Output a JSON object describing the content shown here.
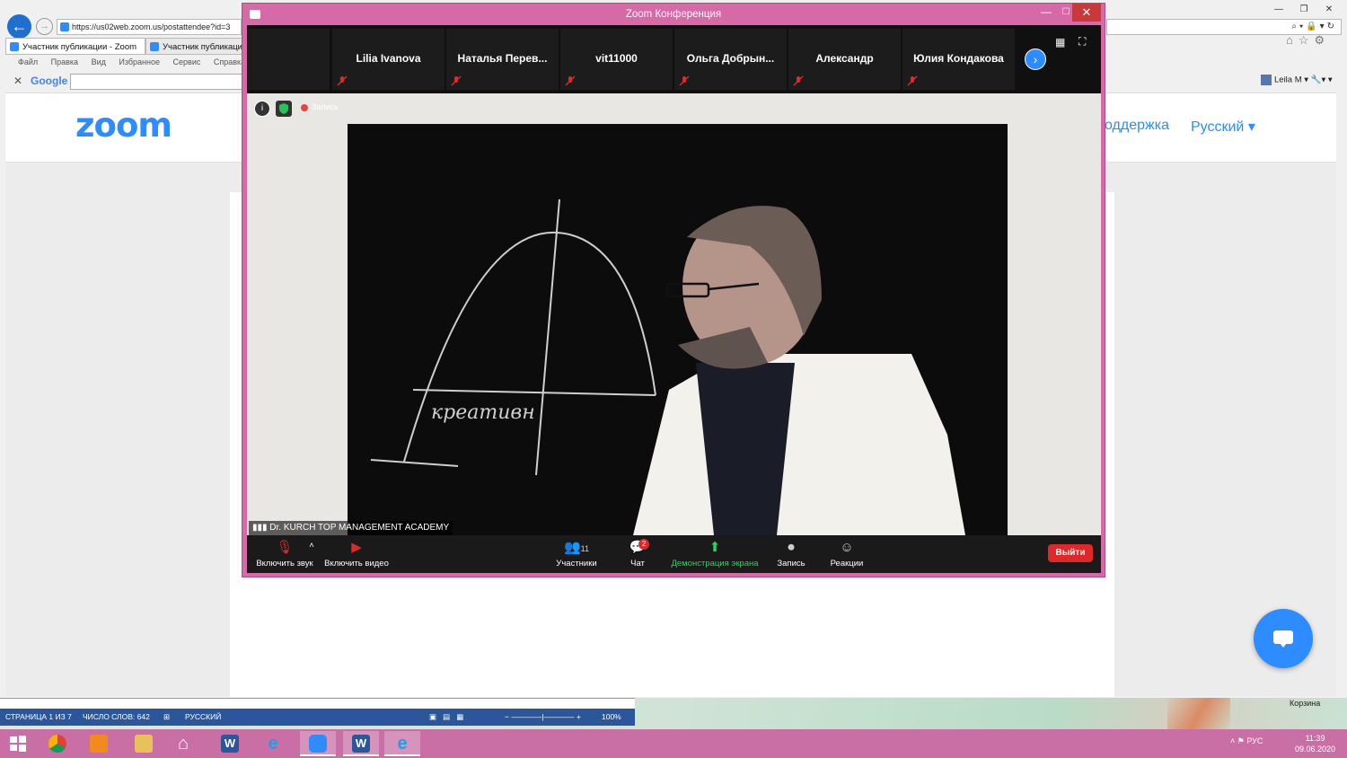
{
  "browser": {
    "url": "https://us02web.zoom.us/postattendee?id=3",
    "tabs": [
      {
        "label": "Участник публикации - Zoom"
      },
      {
        "label": "Участник публикаци"
      }
    ],
    "menu": [
      "Файл",
      "Правка",
      "Вид",
      "Избранное",
      "Сервис",
      "Справка"
    ],
    "google_logo": "Google",
    "user_name": "Leila M ▾"
  },
  "webpage": {
    "logo": "zoom",
    "nav_support": "оддержка",
    "nav_language": "Русский ▾"
  },
  "zoom_window": {
    "title": "Zoom Конференция",
    "participants_strip": [
      {
        "name": "Lilia Ivanova"
      },
      {
        "name": "Наталья  Перев..."
      },
      {
        "name": "vit11000"
      },
      {
        "name": "Ольга  Добрын..."
      },
      {
        "name": "Александр"
      },
      {
        "name": "Юлия Кондакова"
      }
    ],
    "recording_label": "Запись",
    "active_speaker": "Dr. KURCH TOP MANAGEMENT ACADEMY",
    "board_text": "креативн",
    "toolbar": {
      "unmute": "Включить звук",
      "start_video": "Включить видео",
      "participants": "Участники",
      "participants_count": "11",
      "chat": "Чат",
      "chat_badge": "2",
      "share_screen": "Демонстрация экрана",
      "record": "Запись",
      "reactions": "Реакции",
      "leave": "Выйти"
    }
  },
  "word_status": {
    "page": "СТРАНИЦА 1 ИЗ 7",
    "words": "ЧИСЛО СЛОВ: 642",
    "language": "РУССКИЙ",
    "zoom": "100%"
  },
  "desktop": {
    "recycle_bin": "Корзина"
  },
  "taskbar": {
    "lang": "РУС",
    "time": "11:39",
    "date": "09.06.2020"
  },
  "colors": {
    "zoom_blue": "#2d8cff",
    "zoom_window_border": "#d56aa6",
    "leave_red": "#e02828",
    "share_green": "#23d959",
    "taskbar": "#c96fa5"
  }
}
